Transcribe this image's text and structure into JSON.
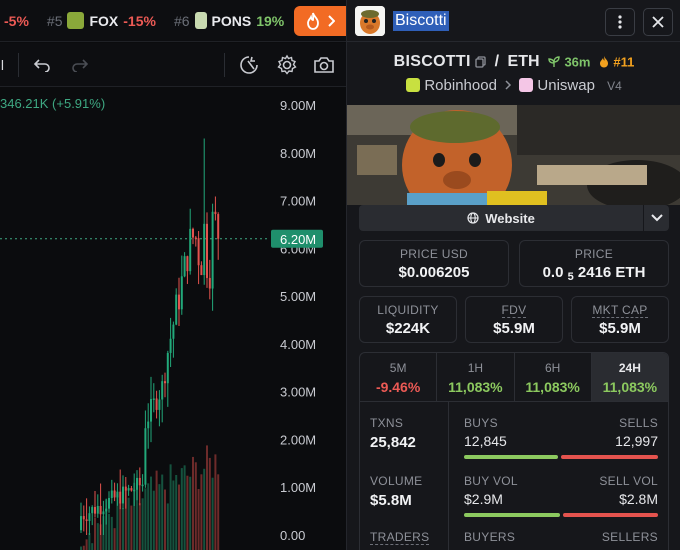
{
  "ticker": {
    "items": [
      {
        "rank": "",
        "name": "",
        "change": "-5%",
        "change_color": "#ec5a55"
      },
      {
        "rank": "#5",
        "name": "FOX",
        "change": "-15%",
        "change_color": "#ec5a55",
        "logo_color": "#8aa83a"
      },
      {
        "rank": "#6",
        "name": "PONS",
        "change": "19%",
        "change_color": "#7fc46a",
        "logo_color": "#c8d9b0"
      }
    ],
    "fire_icon": "fire-icon",
    "accent": "#f26b24"
  },
  "toolbar": {
    "left_fragment": "all"
  },
  "chart": {
    "legend": "346.21K (+5.91%)",
    "price_tag": "6.20M",
    "axis_labels": [
      "9.00M",
      "8.00M",
      "7.00M",
      "6.00M",
      "5.00M",
      "4.00M",
      "3.00M",
      "2.00M",
      "1.00M",
      "0.00"
    ]
  },
  "chart_data": {
    "type": "candlestick",
    "ylim": [
      0,
      9.0
    ],
    "current_value": 6.2,
    "up_color": "#22a97a",
    "down_color": "#e4534e"
  },
  "header": {
    "title": "Biscotti",
    "menu_icon": "kebab-menu-icon",
    "close_icon": "close-icon"
  },
  "pair": {
    "base": "BISCOTTI",
    "separator": "/",
    "quote": "ETH",
    "age": "36m",
    "rank": "#11",
    "platform": "Robinhood",
    "dex": "Uniswap",
    "version": "V4"
  },
  "website": {
    "label": "Website"
  },
  "prices": {
    "usd_label": "PRICE USD",
    "usd_value": "$0.006205",
    "native_label": "PRICE",
    "native_prefix": "0.0",
    "native_subscript": "5",
    "native_digits": "2416 ETH"
  },
  "metrics": [
    {
      "label": "LIQUIDITY",
      "value": "$224K"
    },
    {
      "label": "FDV",
      "value": "$5.9M"
    },
    {
      "label": "MKT CAP",
      "value": "$5.9M"
    }
  ],
  "timeframes": [
    {
      "label": "5M",
      "value": "-9.46%",
      "color": "#ec5a55"
    },
    {
      "label": "1H",
      "value": "11,083%",
      "color": "#8cc95f"
    },
    {
      "label": "6H",
      "value": "11,083%",
      "color": "#8cc95f"
    },
    {
      "label": "24H",
      "value": "11,083%",
      "color": "#8cc95f",
      "selected": true
    }
  ],
  "stats": {
    "txns_label": "TXNS",
    "txns_value": "25,842",
    "buys_label": "BUYS",
    "buys_value": "12,845",
    "sells_label": "SELLS",
    "sells_value": "12,997",
    "volume_label": "VOLUME",
    "volume_value": "$5.8M",
    "buy_vol_label": "BUY VOL",
    "buy_vol_value": "$2.9M",
    "sell_vol_label": "SELL VOL",
    "sell_vol_value": "$2.8M",
    "traders_label": "TRADERS",
    "buyers_label": "BUYERS",
    "sellers_label": "SELLERS"
  }
}
